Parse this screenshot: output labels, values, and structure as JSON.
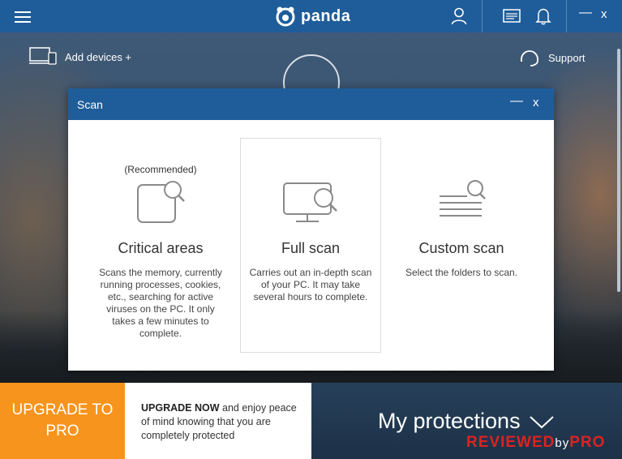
{
  "topbar": {
    "logo_text": "panda",
    "icons": [
      "menu-icon",
      "user-icon",
      "news-icon",
      "bell-icon"
    ],
    "minimize": "—",
    "close": "x"
  },
  "header": {
    "add_devices": "Add devices +",
    "support": "Support"
  },
  "dialog": {
    "title": "Scan",
    "minimize": "—",
    "close": "x",
    "options": [
      {
        "recommended": "(Recommended)",
        "name": "Critical areas",
        "desc": "Scans the memory, currently running processes, cookies, etc., searching for active viruses on the PC. It only takes a few minutes to complete."
      },
      {
        "recommended": "",
        "name": "Full scan",
        "desc": "Carries out an in-depth scan of your PC. It may take several hours to complete."
      },
      {
        "recommended": "",
        "name": "Custom scan",
        "desc": "Select the folders to scan."
      }
    ]
  },
  "bottom": {
    "upgrade_pro_line1": "UPGRADE TO",
    "upgrade_pro_line2": "PRO",
    "upgrade_now": "UPGRADE NOW",
    "upgrade_rest": " and enjoy peace of mind knowing that you are completely protected",
    "my_protections": "My protections"
  },
  "watermark": {
    "part1": "REVIEWED",
    "part2": "by",
    "part3": "PRO"
  },
  "colors": {
    "brand_blue": "#1f5d9a",
    "upgrade_orange": "#f7941d"
  }
}
